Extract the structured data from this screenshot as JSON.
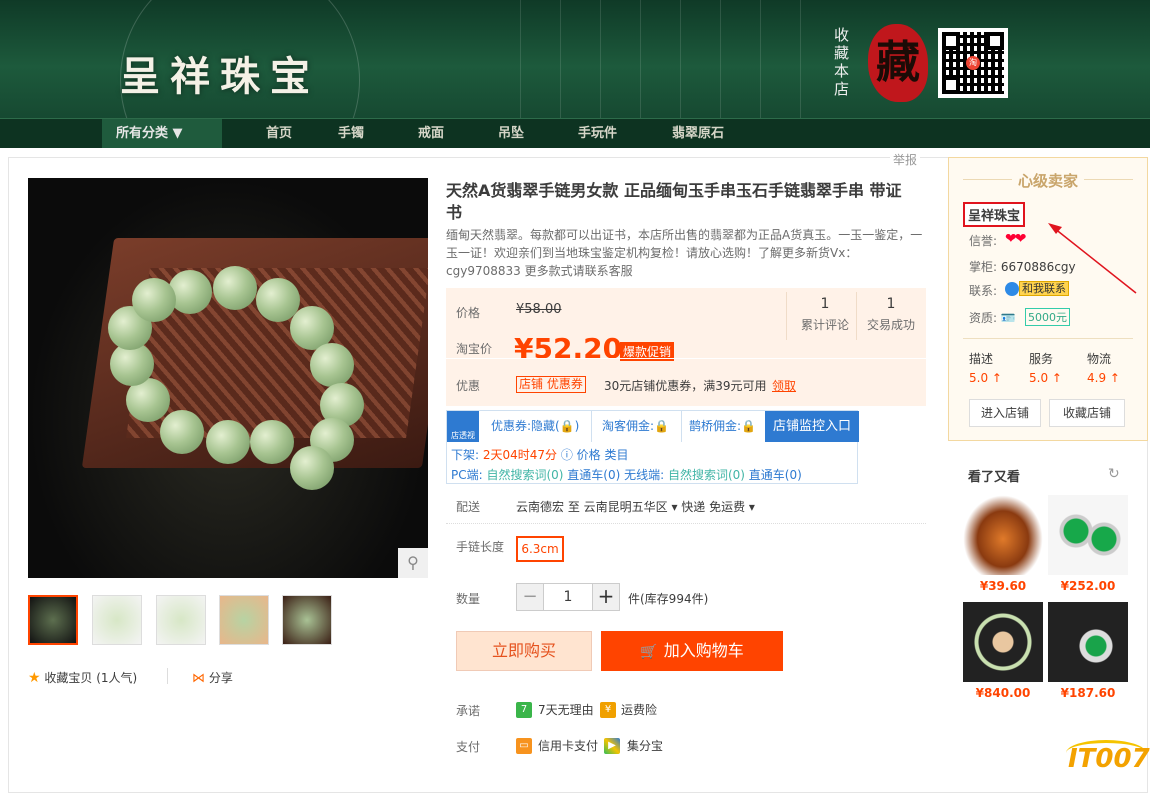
{
  "banner": {
    "shop_logo": "呈祥珠宝",
    "collect_text": "收藏本店",
    "seal_char": "藏",
    "qr_center": "淘",
    "nav": {
      "all_category": "所有分类 ▼",
      "items": [
        "首页",
        "手镯",
        "戒面",
        "吊坠",
        "手玩件",
        "翡翠原石"
      ]
    }
  },
  "report": "举报",
  "gallery": {
    "zoom_icon": "magnifier-icon",
    "favorite": "收藏宝贝 (1人气)",
    "share": "分享"
  },
  "product": {
    "title": "天然A货翡翠手链男女款 正品缅甸玉手串玉石手链翡翠手串 带证书",
    "subtitle": "缅甸天然翡翠。每款都可以出证书，本店所出售的翡翠都为正品A货真玉。一玉一鉴定，一玉一证！欢迎亲们到当地珠宝鉴定机构复检！请放心选购！了解更多新货Vx：cgy9708833 更多款式请联系客服",
    "price_label": "价格",
    "orig_price": "¥58.00",
    "tb_price_label": "淘宝价",
    "price": "¥52.20",
    "price_tag": "爆款促销",
    "stats": [
      {
        "value": "1",
        "label": "累计评论"
      },
      {
        "value": "1",
        "label": "交易成功"
      }
    ],
    "promo_label": "优惠",
    "coupon_tag": "店铺 优惠券",
    "coupon_text": "30元店铺优惠券，满39元可用",
    "coupon_get": "领取"
  },
  "plugin": {
    "logo": "店透视",
    "tabs": [
      "优惠券:隐藏(🔒)",
      "淘客佣金:🔒",
      "鹊桥佣金:🔒"
    ],
    "monitor": "店铺监控入口",
    "line1_prefix": "下架: ",
    "line1_time": "2天04时47分",
    "line1_rest": " ⓘ 价格 类目",
    "line2_pc": "PC端: ",
    "line2_search": "自然搜索词(0)",
    "line2_direct": " 直通车(0) ",
    "line2_wifi": "无线端: ",
    "line2_search2": "自然搜索词(0)",
    "line2_direct2": " 直通车(0)"
  },
  "options": {
    "ship_label": "配送",
    "ship_text": "云南德宏 至  云南昆明五华区 ▾   快递 免运费 ▾",
    "length_label": "手链长度",
    "length_value": "6.3cm",
    "qty_label": "数量",
    "qty_minus": "−",
    "qty_value": "1",
    "qty_plus": "+",
    "stock": "件(库存994件)",
    "buy_now": "立即购买",
    "add_cart": "加入购物车",
    "promise_label": "承诺",
    "promise1": "7天无理由",
    "promise2": "运费险",
    "pay_label": "支付",
    "pay1": "信用卡支付",
    "pay2": "集分宝"
  },
  "seller": {
    "level": "心级卖家",
    "name": "呈祥珠宝",
    "credit_label": "信誉:",
    "hearts": "❤❤",
    "owner_label": "掌柜:",
    "owner": "6670886cgy",
    "contact_label": "联系:",
    "contact_btn": "和我联系",
    "qual_label": "资质:",
    "deposit": "5000元",
    "scores": [
      {
        "label": "描述",
        "value": "5.0 ↑"
      },
      {
        "label": "服务",
        "value": "5.0 ↑"
      },
      {
        "label": "物流",
        "value": "4.9 ↑"
      }
    ],
    "enter_shop": "进入店铺",
    "collect_shop": "收藏店铺"
  },
  "related": {
    "title": "看了又看",
    "items": [
      {
        "price": "¥39.60"
      },
      {
        "price": "¥252.00"
      },
      {
        "price": "¥840.00"
      },
      {
        "price": "¥187.60"
      }
    ]
  },
  "watermark": "IT007",
  "colors": {
    "accent": "#ff4400",
    "banner": "#1d5a3c",
    "link": "#2e7ad1"
  }
}
